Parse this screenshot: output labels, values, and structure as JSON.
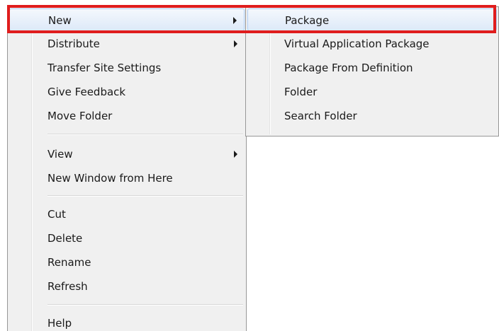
{
  "context_menu": {
    "items": [
      {
        "label": "New",
        "has_submenu": true,
        "highlighted": true
      },
      {
        "label": "Distribute",
        "has_submenu": true
      },
      {
        "label": "Transfer Site Settings"
      },
      {
        "label": "Give Feedback"
      },
      {
        "label": "Move Folder"
      },
      {
        "label": "View",
        "has_submenu": true
      },
      {
        "label": "New Window from Here"
      },
      {
        "label": "Cut"
      },
      {
        "label": "Delete"
      },
      {
        "label": "Rename"
      },
      {
        "label": "Refresh"
      },
      {
        "label": "Help"
      }
    ]
  },
  "submenu": {
    "items": [
      {
        "label": "Package",
        "highlighted": true
      },
      {
        "label": "Virtual Application Package"
      },
      {
        "label": "Package From Definition"
      },
      {
        "label": "Folder"
      },
      {
        "label": "Search Folder"
      }
    ]
  },
  "colors": {
    "highlight_frame": "#e01d1d",
    "menu_background": "#f0f0f0",
    "hover_border": "#aecff7"
  }
}
